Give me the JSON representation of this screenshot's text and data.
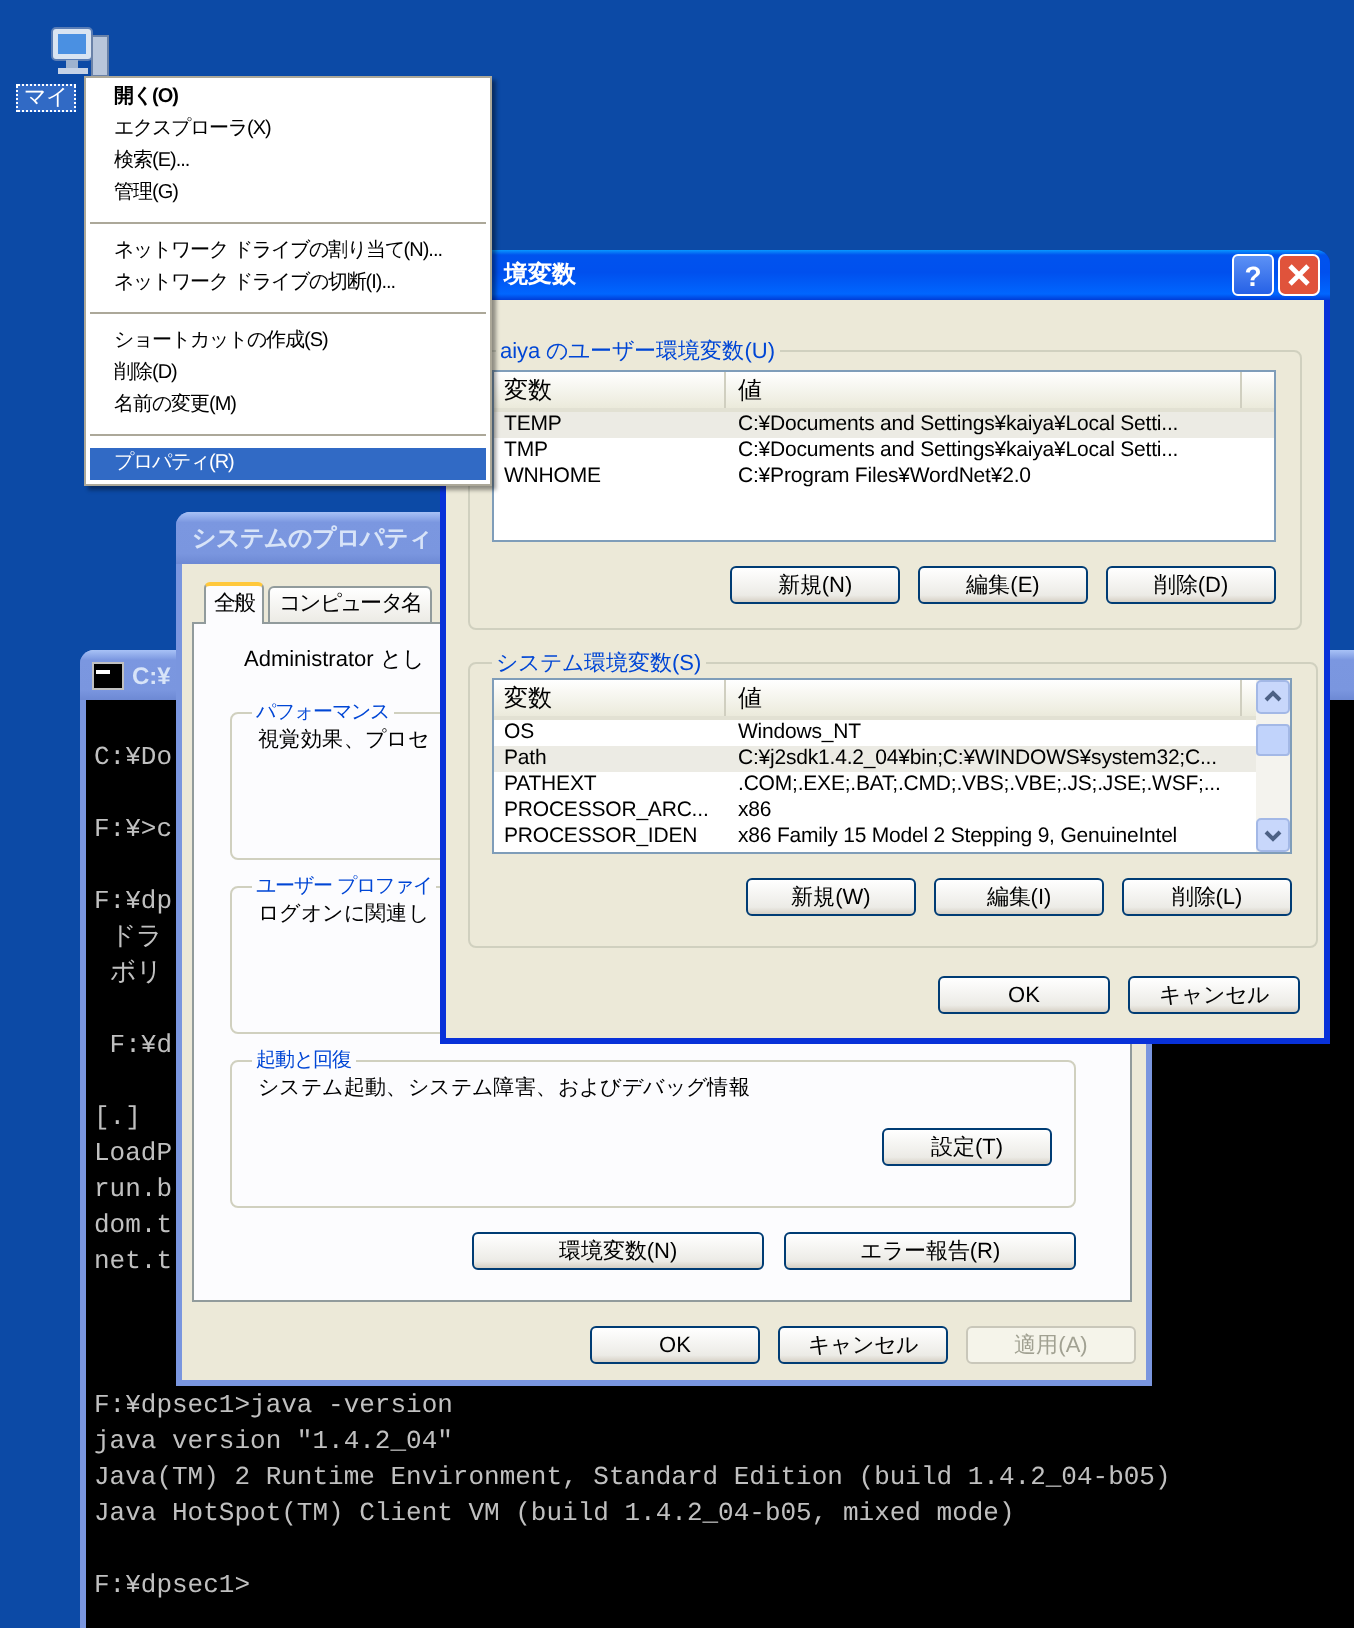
{
  "desktop_icon": {
    "label": "マイ"
  },
  "context_menu": {
    "groups": [
      {
        "items": [
          {
            "label": "開く(O)",
            "default": true,
            "selected": false
          },
          {
            "label": "エクスプローラ(X)",
            "default": false,
            "selected": false
          },
          {
            "label": "検索(E)...",
            "default": false,
            "selected": false
          },
          {
            "label": "管理(G)",
            "default": false,
            "selected": false
          }
        ]
      },
      {
        "items": [
          {
            "label": "ネットワーク ドライブの割り当て(N)...",
            "default": false,
            "selected": false
          },
          {
            "label": "ネットワーク ドライブの切断(I)...",
            "default": false,
            "selected": false
          }
        ]
      },
      {
        "items": [
          {
            "label": "ショートカットの作成(S)",
            "default": false,
            "selected": false
          },
          {
            "label": "削除(D)",
            "default": false,
            "selected": false
          },
          {
            "label": "名前の変更(M)",
            "default": false,
            "selected": false
          }
        ]
      },
      {
        "items": [
          {
            "label": "プロパティ(R)",
            "default": false,
            "selected": true
          }
        ]
      }
    ]
  },
  "console": {
    "title": "C:¥",
    "lines": [
      {
        "kind": "text",
        "text": "C:¥Do"
      },
      {
        "kind": "blank"
      },
      {
        "kind": "text",
        "text": "F:¥>c"
      },
      {
        "kind": "blank"
      },
      {
        "kind": "text",
        "text": "F:¥dp"
      },
      {
        "kind": "text",
        "text": " ドラ"
      },
      {
        "kind": "text",
        "text": " ボリ"
      },
      {
        "kind": "blank"
      },
      {
        "kind": "text",
        "text": " F:¥d"
      },
      {
        "kind": "blank"
      },
      {
        "kind": "text",
        "text": "[.]"
      },
      {
        "kind": "text",
        "text": "LoadP"
      },
      {
        "kind": "text",
        "text": "run.b"
      },
      {
        "kind": "text",
        "text": "dom.t"
      },
      {
        "kind": "text",
        "text": "net.t"
      },
      {
        "kind": "blank"
      },
      {
        "kind": "blank"
      },
      {
        "kind": "blank"
      },
      {
        "kind": "text",
        "text": "F:¥dpsec1>java -version"
      },
      {
        "kind": "text",
        "text": "java version \"1.4.2_04\""
      },
      {
        "kind": "text",
        "text": "Java(TM) 2 Runtime Environment, Standard Edition (build 1.4.2_04-b05)"
      },
      {
        "kind": "text",
        "text": "Java HotSpot(TM) Client VM (build 1.4.2_04-b05, mixed mode)"
      },
      {
        "kind": "blank"
      },
      {
        "kind": "text",
        "text": "F:¥dpsec1>"
      }
    ]
  },
  "system_properties": {
    "title": "システムのプロパティ",
    "tabs": [
      {
        "label": "全般",
        "selected": true
      },
      {
        "label": "コンピュータ名",
        "selected": false
      }
    ],
    "intro": "Administrator とし",
    "groups": [
      {
        "label": "パフォーマンス",
        "text": "視覚効果、プロセ"
      },
      {
        "label": "ユーザー プロファイ",
        "text": "ログオンに関連し"
      },
      {
        "label": "起動と回復",
        "text": "システム起動、システム障害、およびデバッグ情報",
        "button": "設定(T)"
      }
    ],
    "buttons": [
      {
        "label": "環境変数(N)",
        "disabled": false
      },
      {
        "label": "エラー報告(R)",
        "disabled": false
      }
    ],
    "footer_buttons": [
      {
        "label": "OK",
        "disabled": false
      },
      {
        "label": "キャンセル",
        "disabled": false
      },
      {
        "label": "適用(A)",
        "disabled": true
      }
    ]
  },
  "environment_dialog": {
    "title": "境変数",
    "help_button": "?",
    "user_group": {
      "label": "aiya のユーザー環境変数(U)",
      "columns": [
        "変数",
        "値"
      ],
      "rows": [
        {
          "name": "TEMP",
          "value": "C:¥Documents and Settings¥kaiya¥Local Setti...",
          "selected": true
        },
        {
          "name": "TMP",
          "value": "C:¥Documents and Settings¥kaiya¥Local Setti...",
          "selected": false
        },
        {
          "name": "WNHOME",
          "value": "C:¥Program Files¥WordNet¥2.0",
          "selected": false
        }
      ],
      "buttons": [
        {
          "label": "新規(N)",
          "disabled": false
        },
        {
          "label": "編集(E)",
          "disabled": false
        },
        {
          "label": "削除(D)",
          "disabled": false
        }
      ]
    },
    "system_group": {
      "label": "システム環境変数(S)",
      "columns": [
        "変数",
        "値"
      ],
      "rows": [
        {
          "name": "OS",
          "value": "Windows_NT",
          "selected": false
        },
        {
          "name": "Path",
          "value": "C:¥j2sdk1.4.2_04¥bin;C:¥WINDOWS¥system32;C...",
          "selected": true
        },
        {
          "name": "PATHEXT",
          "value": ".COM;.EXE;.BAT;.CMD;.VBS;.VBE;.JS;.JSE;.WSF;...",
          "selected": false
        },
        {
          "name": "PROCESSOR_ARC...",
          "value": "x86",
          "selected": false
        },
        {
          "name": "PROCESSOR_IDEN",
          "value": "x86 Family 15 Model 2 Stepping 9, GenuineIntel",
          "selected": false
        }
      ],
      "buttons": [
        {
          "label": "新規(W)",
          "disabled": false
        },
        {
          "label": "編集(I)",
          "disabled": false
        },
        {
          "label": "削除(L)",
          "disabled": false
        }
      ]
    },
    "footer_buttons": [
      {
        "label": "OK",
        "disabled": false
      },
      {
        "label": "キャンセル",
        "disabled": false
      }
    ]
  }
}
